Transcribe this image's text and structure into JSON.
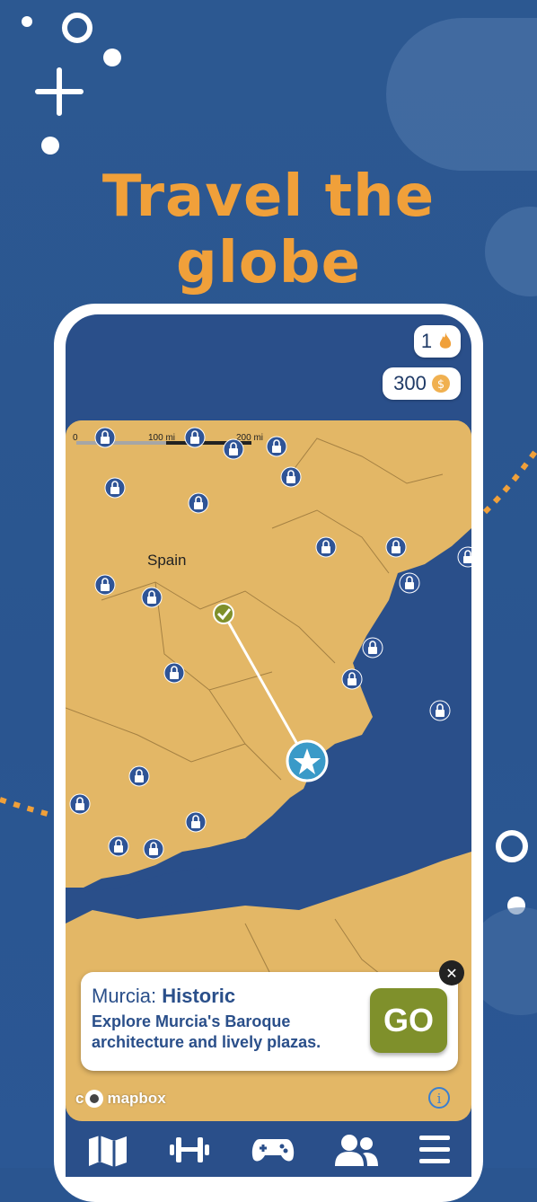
{
  "headline": "Travel the globe",
  "streak": {
    "count": "1",
    "icon": "flame-icon"
  },
  "coins": {
    "count": "300",
    "icon": "coin-icon"
  },
  "map": {
    "country_label": "Spain",
    "scale": {
      "zero": "0",
      "mid": "100 mi",
      "max": "200 mi"
    },
    "attribution": "mapbox",
    "attribution_prefix": "c"
  },
  "destination_card": {
    "city": "Murcia:",
    "category": "Historic",
    "description": "Explore Murcia's Baroque architecture and lively plazas.",
    "go_label": "GO"
  },
  "nav": [
    "map-icon",
    "dumbbell-icon",
    "gamepad-icon",
    "friends-icon",
    "menu-icon"
  ],
  "colors": {
    "accent": "#f0a03a",
    "background": "#2a5590",
    "go_button": "#7f902b",
    "land": "#e3b766",
    "water": "#2a4f8a"
  }
}
